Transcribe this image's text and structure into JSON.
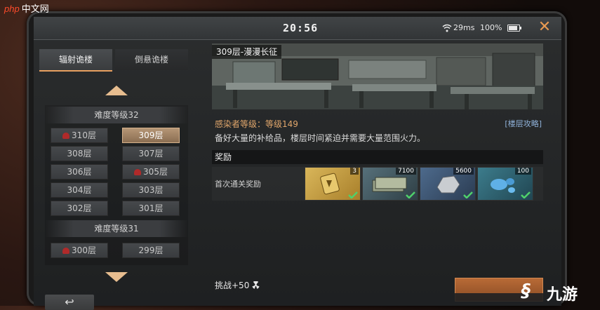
{
  "watermark": {
    "brand": "php",
    "text": "中文网"
  },
  "status": {
    "time": "20:56",
    "ping": "29ms",
    "battery": "100%"
  },
  "tabs": [
    {
      "label": "辐射诡楼",
      "active": true
    },
    {
      "label": "倒悬诡楼",
      "active": false
    }
  ],
  "floors": {
    "group1_header": "难度等级32",
    "group2_header": "难度等级31",
    "items": [
      {
        "label": "310层",
        "skull": true
      },
      {
        "label": "309层",
        "selected": true
      },
      {
        "label": "308层"
      },
      {
        "label": "307层"
      },
      {
        "label": "306层"
      },
      {
        "label": "305层",
        "skull": true
      },
      {
        "label": "304层"
      },
      {
        "label": "303层"
      },
      {
        "label": "302层"
      },
      {
        "label": "301层"
      },
      {
        "label": "300层",
        "skull": true
      },
      {
        "label": "299层"
      }
    ]
  },
  "detail": {
    "title": "309层-漫漫长征",
    "infected_level": "感染者等级：等级149",
    "guide_link": "[楼层攻略]",
    "description": "备好大量的补给品，楼层时间紧迫并需要大量范围火力。",
    "reward_header": "奖励",
    "first_clear_label": "首次通关奖励",
    "rewards": [
      {
        "count": "3",
        "icon": "gold-badge-icon",
        "color": "#c9a03a",
        "claimed": true
      },
      {
        "count": "7100",
        "icon": "cash-stack-icon",
        "color": "#5b6a6a",
        "claimed": true
      },
      {
        "count": "5600",
        "icon": "metal-ore-icon",
        "color": "#4c6a8a",
        "claimed": true
      },
      {
        "count": "100",
        "icon": "blue-gel-icon",
        "color": "#356d7f",
        "claimed": true
      }
    ],
    "challenge_cost": "挑战+50"
  },
  "logo": {
    "text": "九游"
  }
}
